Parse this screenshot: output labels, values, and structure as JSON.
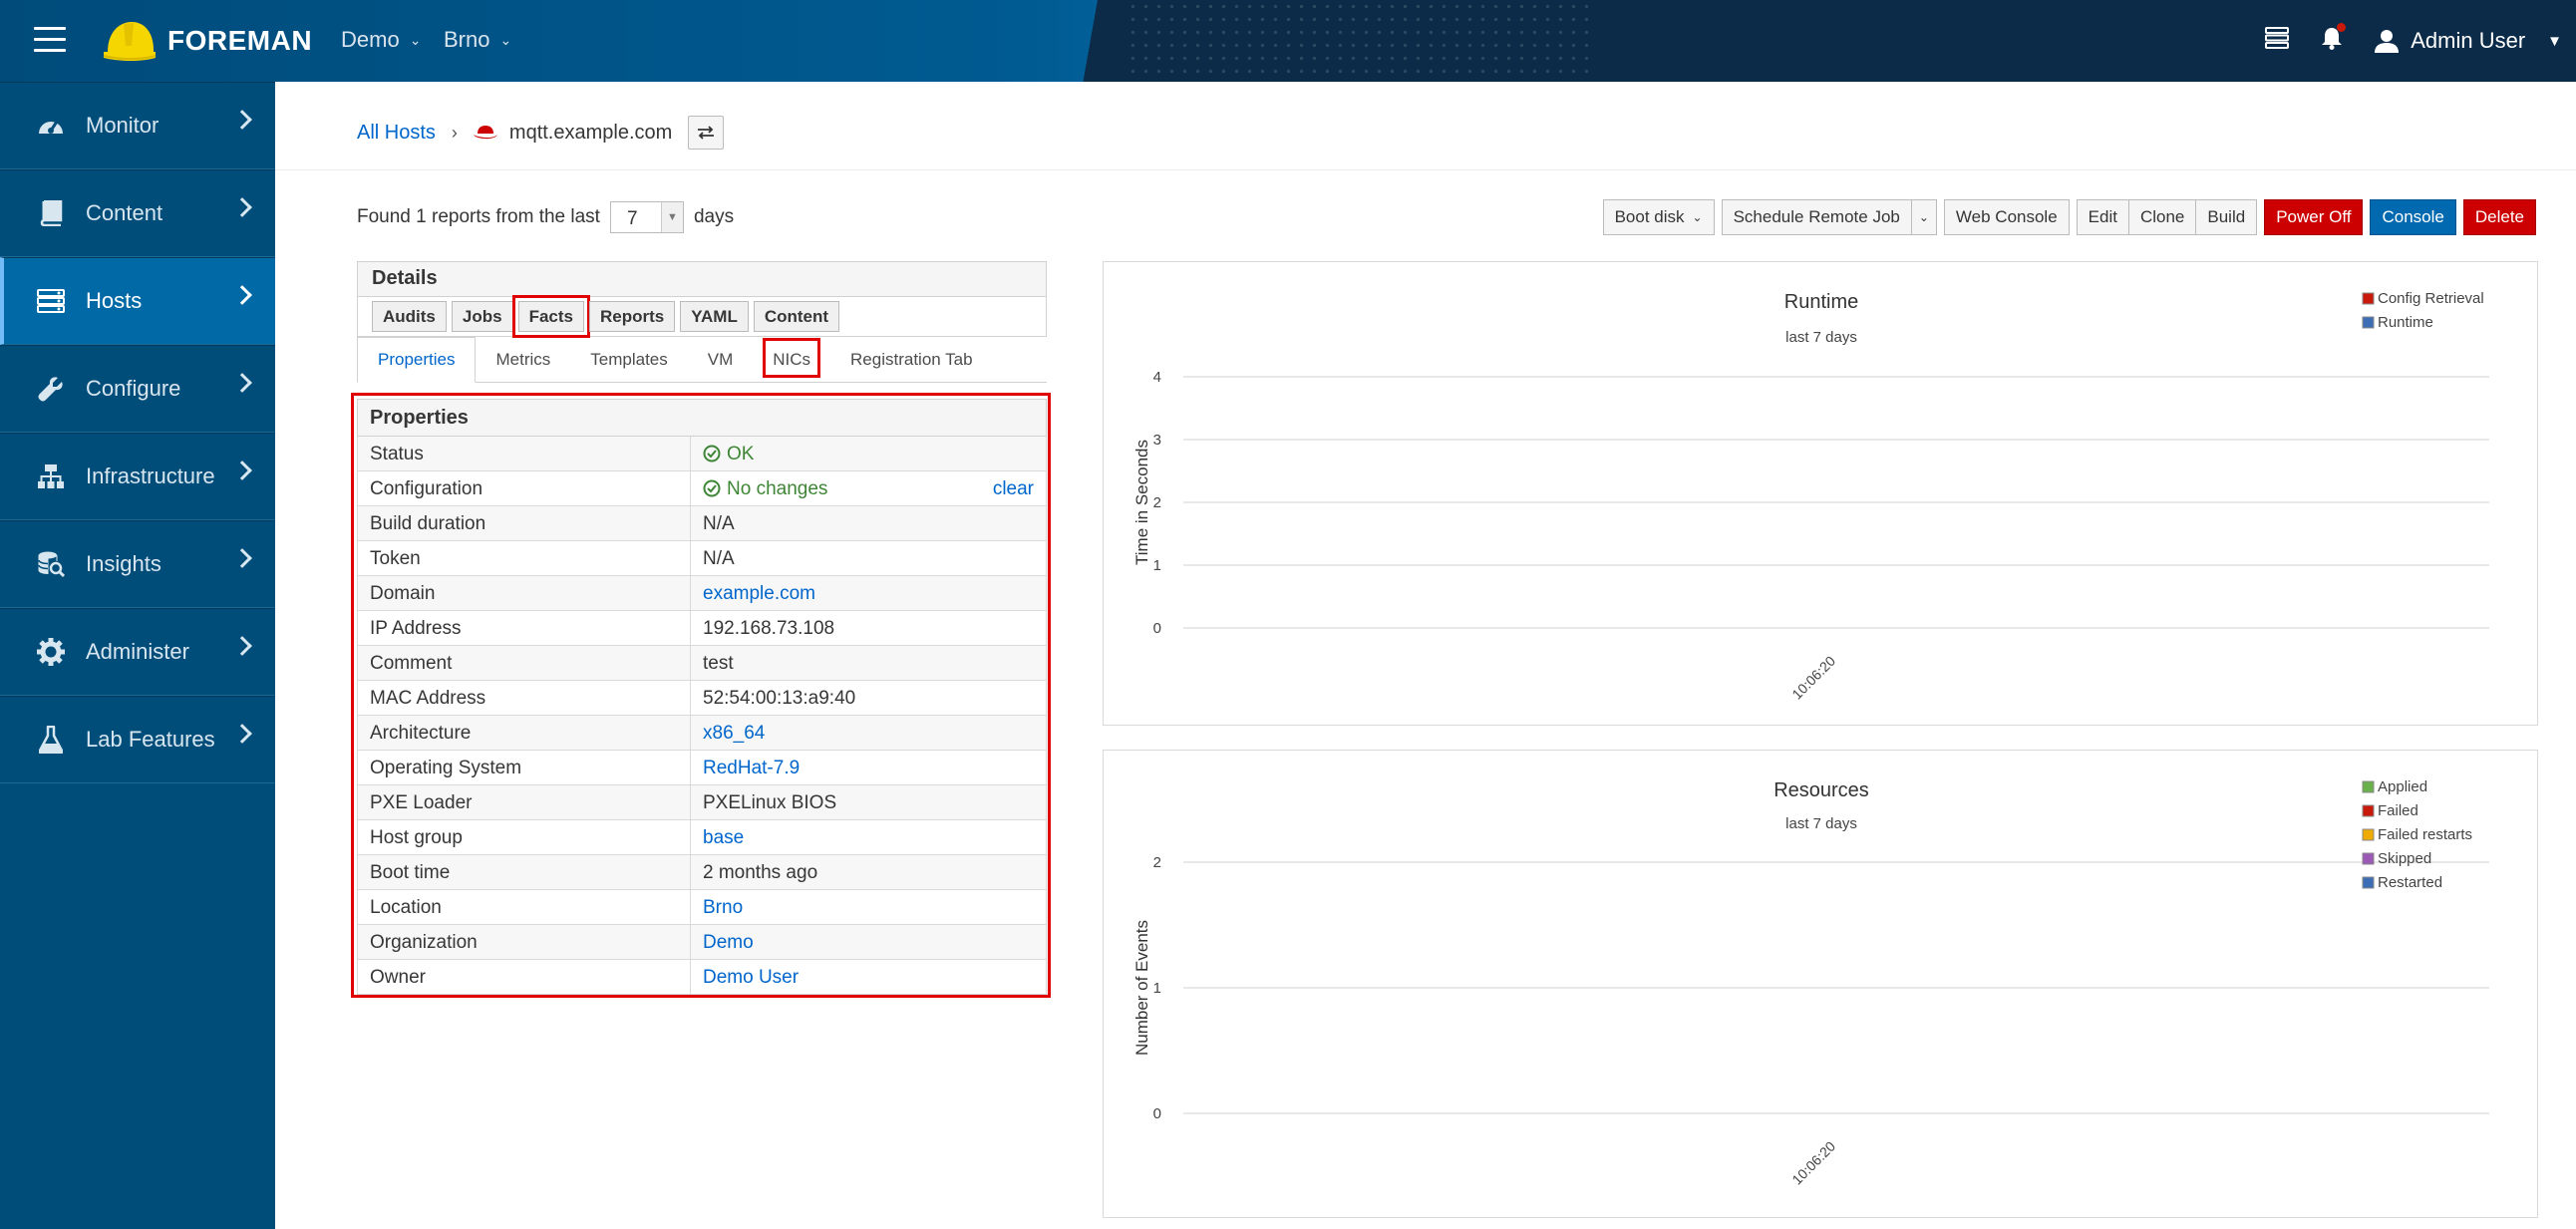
{
  "topbar": {
    "brand": "FOREMAN",
    "org_label": "Demo",
    "loc_label": "Brno",
    "user_label": "Admin User"
  },
  "sidebar": {
    "items": [
      {
        "label": "Monitor",
        "icon": "dashboard-icon"
      },
      {
        "label": "Content",
        "icon": "book-icon"
      },
      {
        "label": "Hosts",
        "icon": "server-icon"
      },
      {
        "label": "Configure",
        "icon": "wrench-icon"
      },
      {
        "label": "Infrastructure",
        "icon": "network-icon"
      },
      {
        "label": "Insights",
        "icon": "database-search-icon"
      },
      {
        "label": "Administer",
        "icon": "gear-icon"
      },
      {
        "label": "Lab Features",
        "icon": "flask-icon"
      }
    ]
  },
  "breadcrumb": {
    "root": "All Hosts",
    "current": "mqtt.example.com"
  },
  "reports": {
    "prefix": "Found 1 reports from the last",
    "value": "7",
    "suffix": "days"
  },
  "actions": {
    "boot_disk": "Boot disk",
    "schedule": "Schedule Remote Job",
    "web_console": "Web Console",
    "edit": "Edit",
    "clone": "Clone",
    "build": "Build",
    "power_off": "Power Off",
    "console": "Console",
    "delete": "Delete"
  },
  "details": {
    "title": "Details",
    "buttons": [
      "Audits",
      "Jobs",
      "Facts",
      "Reports",
      "YAML",
      "Content"
    ],
    "tabs": [
      "Properties",
      "Metrics",
      "Templates",
      "VM",
      "NICs",
      "Registration Tab"
    ]
  },
  "properties": {
    "title": "Properties",
    "clear_label": "clear",
    "rows": [
      {
        "key": "Status",
        "value": "OK"
      },
      {
        "key": "Configuration",
        "value": "No changes"
      },
      {
        "key": "Build duration",
        "value": "N/A"
      },
      {
        "key": "Token",
        "value": "N/A"
      },
      {
        "key": "Domain",
        "value": "example.com"
      },
      {
        "key": "IP Address",
        "value": "192.168.73.108"
      },
      {
        "key": "Comment",
        "value": "test"
      },
      {
        "key": "MAC Address",
        "value": "52:54:00:13:a9:40"
      },
      {
        "key": "Architecture",
        "value": "x86_64"
      },
      {
        "key": "Operating System",
        "value": "RedHat-7.9"
      },
      {
        "key": "PXE Loader",
        "value": "PXELinux BIOS"
      },
      {
        "key": "Host group",
        "value": "base"
      },
      {
        "key": "Boot time",
        "value": "2 months ago"
      },
      {
        "key": "Location",
        "value": "Brno"
      },
      {
        "key": "Organization",
        "value": "Demo"
      },
      {
        "key": "Owner",
        "value": "Demo User"
      }
    ]
  },
  "colors": {
    "accent": "#0066cc",
    "ok": "#3e8635",
    "danger": "#cc0000",
    "primary": "#0069b0",
    "highlight": "#e00000"
  },
  "chart_data": [
    {
      "type": "line",
      "title": "Runtime",
      "subtitle": "last 7 days",
      "ylabel": "Time in Seconds",
      "xlabel": "",
      "ylim": [
        0,
        4
      ],
      "y_ticks": [
        0,
        1,
        2,
        3,
        4
      ],
      "x_tick_labels": [
        "10:06:20"
      ],
      "legend_position": "top-right",
      "series": [
        {
          "name": "Config Retrieval",
          "color": "#c9190b",
          "values": []
        },
        {
          "name": "Runtime",
          "color": "#3d6eb5",
          "values": []
        }
      ]
    },
    {
      "type": "line",
      "title": "Resources",
      "subtitle": "last 7 days",
      "ylabel": "Number of Events",
      "xlabel": "",
      "ylim": [
        0,
        2
      ],
      "y_ticks": [
        0,
        1,
        2
      ],
      "x_tick_labels": [
        "10:06:20"
      ],
      "legend_position": "top-right",
      "series": [
        {
          "name": "Applied",
          "color": "#6ab04c",
          "values": []
        },
        {
          "name": "Failed",
          "color": "#c9190b",
          "values": []
        },
        {
          "name": "Failed restarts",
          "color": "#f0ab00",
          "values": []
        },
        {
          "name": "Skipped",
          "color": "#9b59b6",
          "values": []
        },
        {
          "name": "Restarted",
          "color": "#3d6eb5",
          "values": []
        }
      ]
    }
  ]
}
